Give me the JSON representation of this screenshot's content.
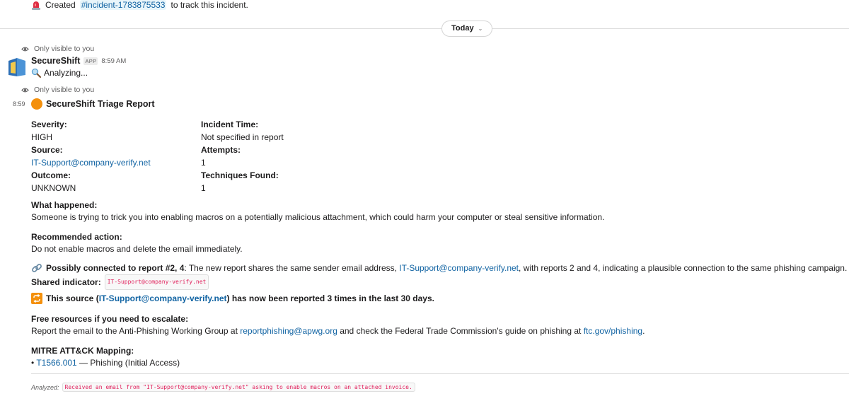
{
  "top_message": {
    "prefix": "Created",
    "channel": "#incident-1783875533",
    "suffix": "to track this incident."
  },
  "date_divider": {
    "label": "Today"
  },
  "messages": [
    {
      "visibility": "Only visible to you",
      "sender": "SecureShift",
      "badge": "APP",
      "time": "8:59 AM",
      "text": "Analyzing..."
    },
    {
      "visibility": "Only visible to you",
      "gutter_time": "8:59",
      "title": "SecureShift Triage Report",
      "fields": {
        "severity_label": "Severity:",
        "severity_value": "HIGH",
        "incident_time_label": "Incident Time:",
        "incident_time_value": "Not specified in report",
        "source_label": "Source:",
        "source_value": "IT-Support@company-verify.net",
        "attempts_label": "Attempts:",
        "attempts_value": "1",
        "outcome_label": "Outcome:",
        "outcome_value": "UNKNOWN",
        "techniques_label": "Techniques Found:",
        "techniques_value": "1"
      },
      "what_happened": {
        "label": "What happened:",
        "text": "Someone is trying to trick you into enabling macros on a potentially malicious attachment, which could harm your computer or steal sensitive information."
      },
      "recommended": {
        "label": "Recommended action:",
        "text": "Do not enable macros and delete the email immediately."
      },
      "connected": {
        "bold": "Possibly connected to report #2, 4",
        "text_before": ": The new report shares the same sender email address, ",
        "link": "IT-Support@company-verify.net",
        "text_after": ", with reports 2 and 4, indicating a plausible connection to the same phishing campaign.",
        "shared_label": "Shared indicator:",
        "shared_value": "IT-Support@company-verify.net"
      },
      "source_report": {
        "prefix": "This source (",
        "link": "IT-Support@company-verify.net",
        "suffix": ") has now been reported 3 times in the last 30 days."
      },
      "resources": {
        "label": "Free resources if you need to escalate:",
        "text_before": "Report the email to the Anti-Phishing Working Group at ",
        "email_link": "reportphishing@apwg.org",
        "text_middle": " and check the Federal Trade Commission's guide on phishing at ",
        "url_link": "ftc.gov/phishing",
        "text_after": "."
      },
      "mitre": {
        "label": "MITRE ATT&CK Mapping:",
        "bullet": "•",
        "technique_id": "T1566.001",
        "technique_desc": " — Phishing (Initial Access)"
      },
      "analyzed": {
        "label": "Analyzed:",
        "value": "Received an email from \"IT-Support@company-verify.net\" asking to enable macros on an attached invoice."
      }
    }
  ],
  "colors": {
    "link": "#1264a3",
    "code_text": "#e01e5a",
    "orange_dot": "#f4900c",
    "muted": "#616061"
  },
  "icons": [
    "rotating-light-icon",
    "eye-icon",
    "app-avatar-icon",
    "magnifier-icon",
    "orange-circle-icon",
    "link-icon",
    "repeat-icon",
    "chevron-down-icon"
  ]
}
